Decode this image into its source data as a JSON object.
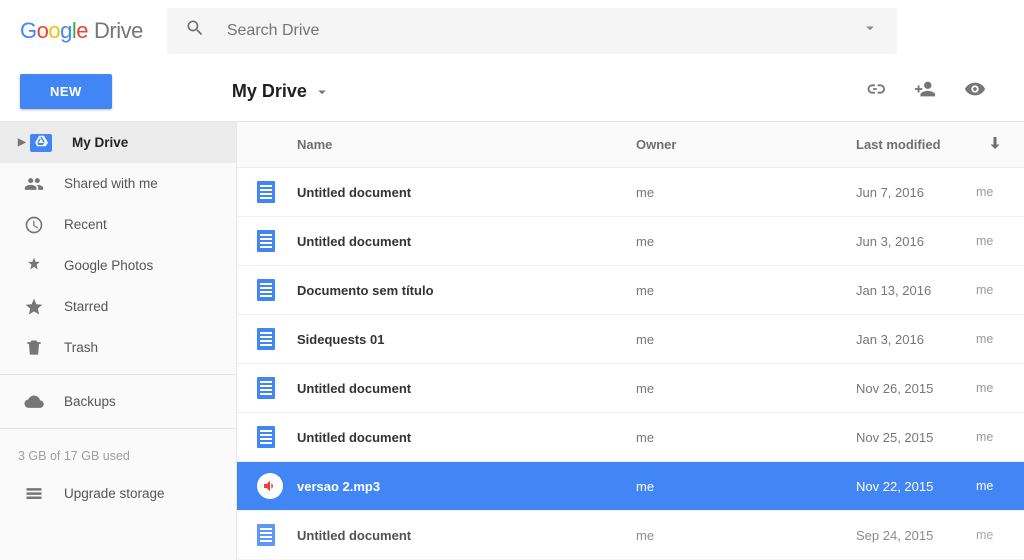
{
  "app": {
    "logo_product": "Drive"
  },
  "search": {
    "placeholder": "Search Drive"
  },
  "toolbar": {
    "new_label": "NEW",
    "folder_title": "My Drive"
  },
  "sidebar": {
    "items": [
      {
        "label": "My Drive"
      },
      {
        "label": "Shared with me"
      },
      {
        "label": "Recent"
      },
      {
        "label": "Google Photos"
      },
      {
        "label": "Starred"
      },
      {
        "label": "Trash"
      },
      {
        "label": "Backups"
      },
      {
        "label": "Upgrade storage"
      }
    ],
    "storage_text": "3 GB of 17 GB used"
  },
  "columns": {
    "name": "Name",
    "owner": "Owner",
    "modified": "Last modified"
  },
  "files": [
    {
      "name": "Untitled document",
      "owner": "me",
      "modified": "Jun 7, 2016",
      "modified_by": "me",
      "type": "doc"
    },
    {
      "name": "Untitled document",
      "owner": "me",
      "modified": "Jun 3, 2016",
      "modified_by": "me",
      "type": "doc"
    },
    {
      "name": "Documento sem título",
      "owner": "me",
      "modified": "Jan 13, 2016",
      "modified_by": "me",
      "type": "doc"
    },
    {
      "name": "Sidequests 01",
      "owner": "me",
      "modified": "Jan 3, 2016",
      "modified_by": "me",
      "type": "doc"
    },
    {
      "name": "Untitled document",
      "owner": "me",
      "modified": "Nov 26, 2015",
      "modified_by": "me",
      "type": "doc"
    },
    {
      "name": "Untitled document",
      "owner": "me",
      "modified": "Nov 25, 2015",
      "modified_by": "me",
      "type": "doc"
    },
    {
      "name": "versao 2.mp3",
      "owner": "me",
      "modified": "Nov 22, 2015",
      "modified_by": "me",
      "type": "audio",
      "selected": true
    },
    {
      "name": "Untitled document",
      "owner": "me",
      "modified": "Sep 24, 2015",
      "modified_by": "me",
      "type": "doc"
    }
  ]
}
